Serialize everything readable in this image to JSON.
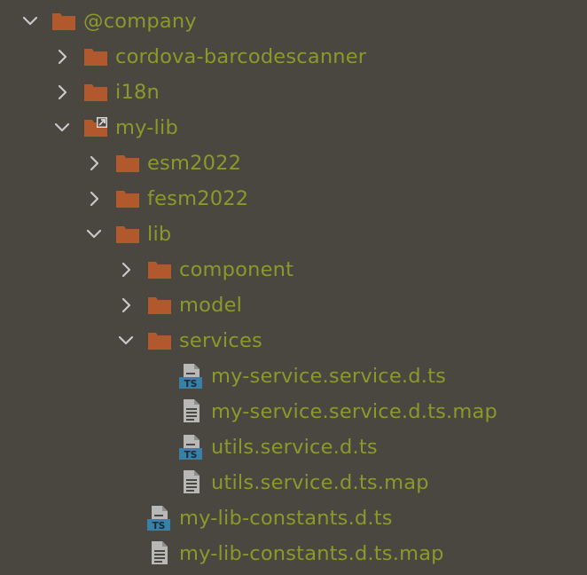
{
  "colors": {
    "background": "#4a4640",
    "label": "#8a9a2a",
    "folder": "#b2582d",
    "chevron": "#c8c8c8",
    "ts_badge": "#3a7fa6",
    "doc": "#b8b8b8"
  },
  "tree": {
    "items": [
      {
        "label": "@company",
        "depth": 0,
        "state": "expanded",
        "icon": "folder-icon"
      },
      {
        "label": "cordova-barcodescanner",
        "depth": 1,
        "state": "collapsed",
        "icon": "folder-icon"
      },
      {
        "label": "i18n",
        "depth": 1,
        "state": "collapsed",
        "icon": "folder-icon"
      },
      {
        "label": "my-lib",
        "depth": 1,
        "state": "expanded",
        "icon": "symlink-folder-icon"
      },
      {
        "label": "esm2022",
        "depth": 2,
        "state": "collapsed",
        "icon": "folder-icon"
      },
      {
        "label": "fesm2022",
        "depth": 2,
        "state": "collapsed",
        "icon": "folder-icon"
      },
      {
        "label": "lib",
        "depth": 2,
        "state": "expanded",
        "icon": "folder-icon"
      },
      {
        "label": "component",
        "depth": 3,
        "state": "collapsed",
        "icon": "folder-icon"
      },
      {
        "label": "model",
        "depth": 3,
        "state": "collapsed",
        "icon": "folder-icon"
      },
      {
        "label": "services",
        "depth": 3,
        "state": "expanded",
        "icon": "folder-icon"
      },
      {
        "label": "my-service.service.d.ts",
        "depth": 4,
        "state": "leaf",
        "icon": "typescript-file-icon"
      },
      {
        "label": "my-service.service.d.ts.map",
        "depth": 4,
        "state": "leaf",
        "icon": "text-file-icon"
      },
      {
        "label": "utils.service.d.ts",
        "depth": 4,
        "state": "leaf",
        "icon": "typescript-file-icon"
      },
      {
        "label": "utils.service.d.ts.map",
        "depth": 4,
        "state": "leaf",
        "icon": "text-file-icon"
      },
      {
        "label": "my-lib-constants.d.ts",
        "depth": 3,
        "state": "leaf",
        "icon": "typescript-file-icon"
      },
      {
        "label": "my-lib-constants.d.ts.map",
        "depth": 3,
        "state": "leaf",
        "icon": "text-file-icon"
      }
    ]
  },
  "badges": {
    "ts": "TS"
  }
}
